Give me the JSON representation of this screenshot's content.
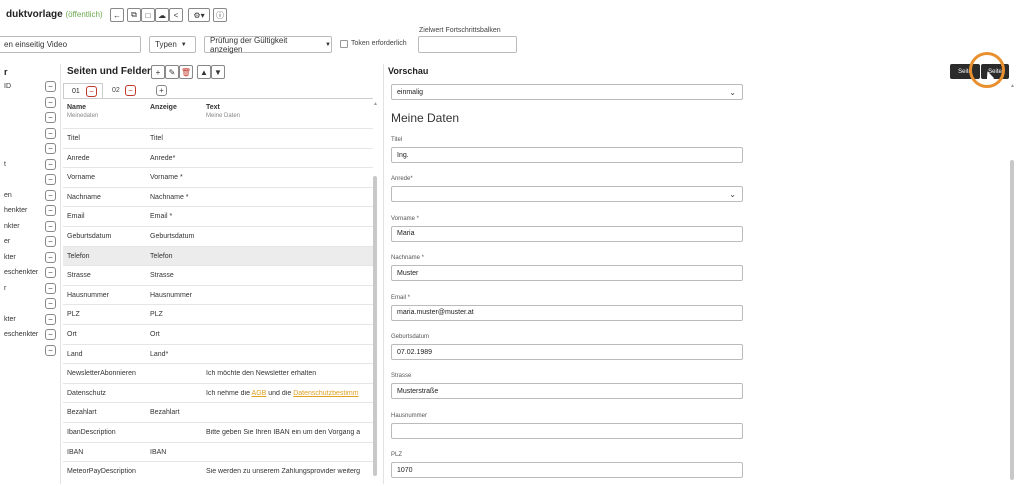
{
  "header": {
    "title": "duktvorlage",
    "visibility": "(öffentlich)",
    "toolbar_icons": [
      "arrow-left-icon",
      "copy-icon",
      "document-icon",
      "cloud-icon",
      "share-icon",
      "gear-icon",
      "info-icon"
    ]
  },
  "filters": {
    "name_value": "en einseitig Video",
    "types_label": "Typen",
    "validity_label": "Prüfung der Gültigkeit anzeigen",
    "token_label": "Token erforderlich",
    "progress_label": "Zielwert Fortschrittsbalken"
  },
  "left_column": {
    "header": "r",
    "items": [
      "ID",
      "",
      "",
      "",
      "",
      "t",
      "",
      "en",
      "henkter",
      "nkter",
      "er",
      "kter",
      "eschenkter",
      "r",
      "",
      "kter",
      "eschenkter",
      ""
    ]
  },
  "fields_panel": {
    "title": "Seiten und Felder",
    "tabs": [
      {
        "label": "01",
        "remove": "−"
      },
      {
        "label": "02",
        "remove": "−"
      }
    ],
    "add_tab": "+",
    "columns": {
      "name": "Name",
      "display": "Anzeige",
      "text": "Text"
    },
    "first_row": {
      "name": "Meinedaten",
      "text": "Meine Daten"
    },
    "rows": [
      {
        "name": "Titel",
        "display": "Titel",
        "text": ""
      },
      {
        "name": "Anrede",
        "display": "Anrede*",
        "text": ""
      },
      {
        "name": "Vorname",
        "display": "Vorname *",
        "text": ""
      },
      {
        "name": "Nachname",
        "display": "Nachname *",
        "text": ""
      },
      {
        "name": "Email",
        "display": "Email *",
        "text": ""
      },
      {
        "name": "Geburtsdatum",
        "display": "Geburtsdatum",
        "text": ""
      },
      {
        "name": "Telefon",
        "display": "Telefon",
        "text": ""
      },
      {
        "name": "Strasse",
        "display": "Strasse",
        "text": ""
      },
      {
        "name": "Hausnummer",
        "display": "Hausnummer",
        "text": ""
      },
      {
        "name": "PLZ",
        "display": "PLZ",
        "text": ""
      },
      {
        "name": "Ort",
        "display": "Ort",
        "text": ""
      },
      {
        "name": "Land",
        "display": "Land*",
        "text": ""
      },
      {
        "name": "NewsletterAbonnieren",
        "display": "",
        "text": "Ich möchte den Newsletter erhalten"
      },
      {
        "name": "Datenschutz",
        "display": "",
        "text": "Ich nehme die ",
        "link1": "AGB",
        "mid": " und die ",
        "link2": "Datenschutzbestimm"
      },
      {
        "name": "Bezahlart",
        "display": "Bezahlart",
        "text": ""
      },
      {
        "name": "IbanDescription",
        "display": "",
        "text": "Bitte geben Sie Ihren IBAN ein um den Vorgang a"
      },
      {
        "name": "IBAN",
        "display": "IBAN",
        "text": ""
      },
      {
        "name": "MeteorPayDescription",
        "display": "",
        "text": "Sie werden zu unserem Zahlungsprovider weiterg"
      }
    ]
  },
  "preview": {
    "title": "Vorschau",
    "select_value": "einmalig",
    "heading": "Meine Daten",
    "fields": [
      {
        "label": "Titel",
        "value": "Ing."
      },
      {
        "label": "Anrede*",
        "value": ""
      },
      {
        "label": "Vorname *",
        "value": "Maria"
      },
      {
        "label": "Nachname *",
        "value": "Muster"
      },
      {
        "label": "Email *",
        "value": "maria.muster@muster.at"
      },
      {
        "label": "Geburtsdatum",
        "value": "07.02.1989"
      },
      {
        "label": "Strasse",
        "value": "Musterstraße"
      },
      {
        "label": "Hausnummer",
        "value": ""
      },
      {
        "label": "PLZ",
        "value": "1070"
      }
    ],
    "btn_left": "Seite",
    "btn_right": "Seite"
  },
  "colors": {
    "accent": "#6aa84f",
    "remove": "#c0392b",
    "link": "#e0a020",
    "highlight_ring": "#e8902f",
    "dark_button": "#2b2b2b"
  }
}
